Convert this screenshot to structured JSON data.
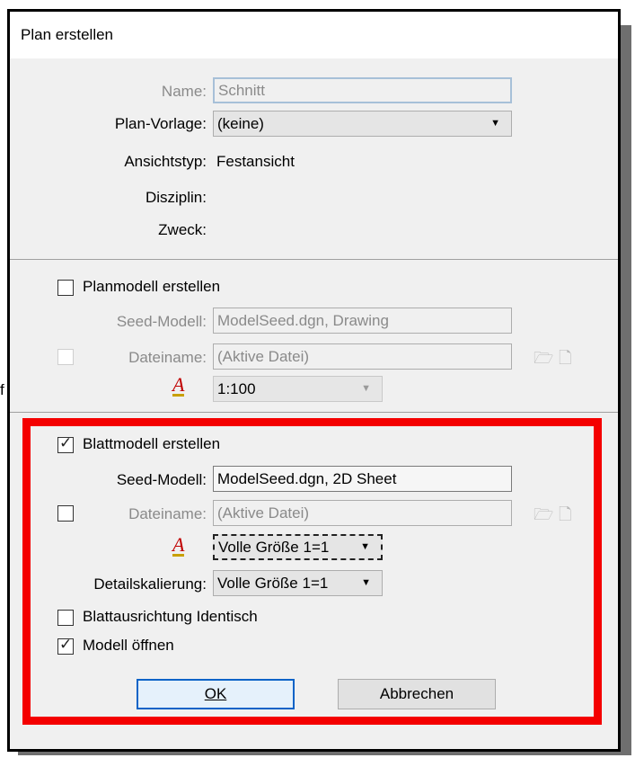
{
  "window": {
    "title": "Plan erstellen"
  },
  "fields": {
    "name_label": "Name:",
    "name_value": "Schnitt",
    "template_label": "Plan-Vorlage:",
    "template_value": "(keine)",
    "viewtype_label": "Ansichtstyp:",
    "viewtype_value": "Festansicht",
    "discipline_label": "Disziplin:",
    "purpose_label": "Zweck:"
  },
  "design_model": {
    "create_label": "Planmodell erstellen",
    "create_checked": false,
    "seed_label": "Seed-Modell:",
    "seed_value": "ModelSeed.dgn, Drawing",
    "filename_label": "Dateiname:",
    "filename_value": "(Aktive Datei)",
    "scale_value": "1:100"
  },
  "sheet_model": {
    "create_label": "Blattmodell erstellen",
    "create_checked": true,
    "seed_label": "Seed-Modell:",
    "seed_value": "ModelSeed.dgn, 2D Sheet",
    "filename_label": "Dateiname:",
    "filename_value": "(Aktive Datei)",
    "scale_value": "Volle Größe 1=1",
    "detail_label": "Detailskalierung:",
    "detail_value": "Volle Größe 1=1",
    "orient_label": "Blattausrichtung Identisch",
    "orient_checked": false,
    "open_label": "Modell öffnen",
    "open_checked": true
  },
  "buttons": {
    "ok": "OK",
    "cancel": "Abbrechen"
  },
  "edge_text": "f",
  "icons": {
    "checkmark": "✓",
    "dropdown": "▼",
    "scale": "A",
    "folder": "🗁",
    "new_file": "🗋"
  }
}
